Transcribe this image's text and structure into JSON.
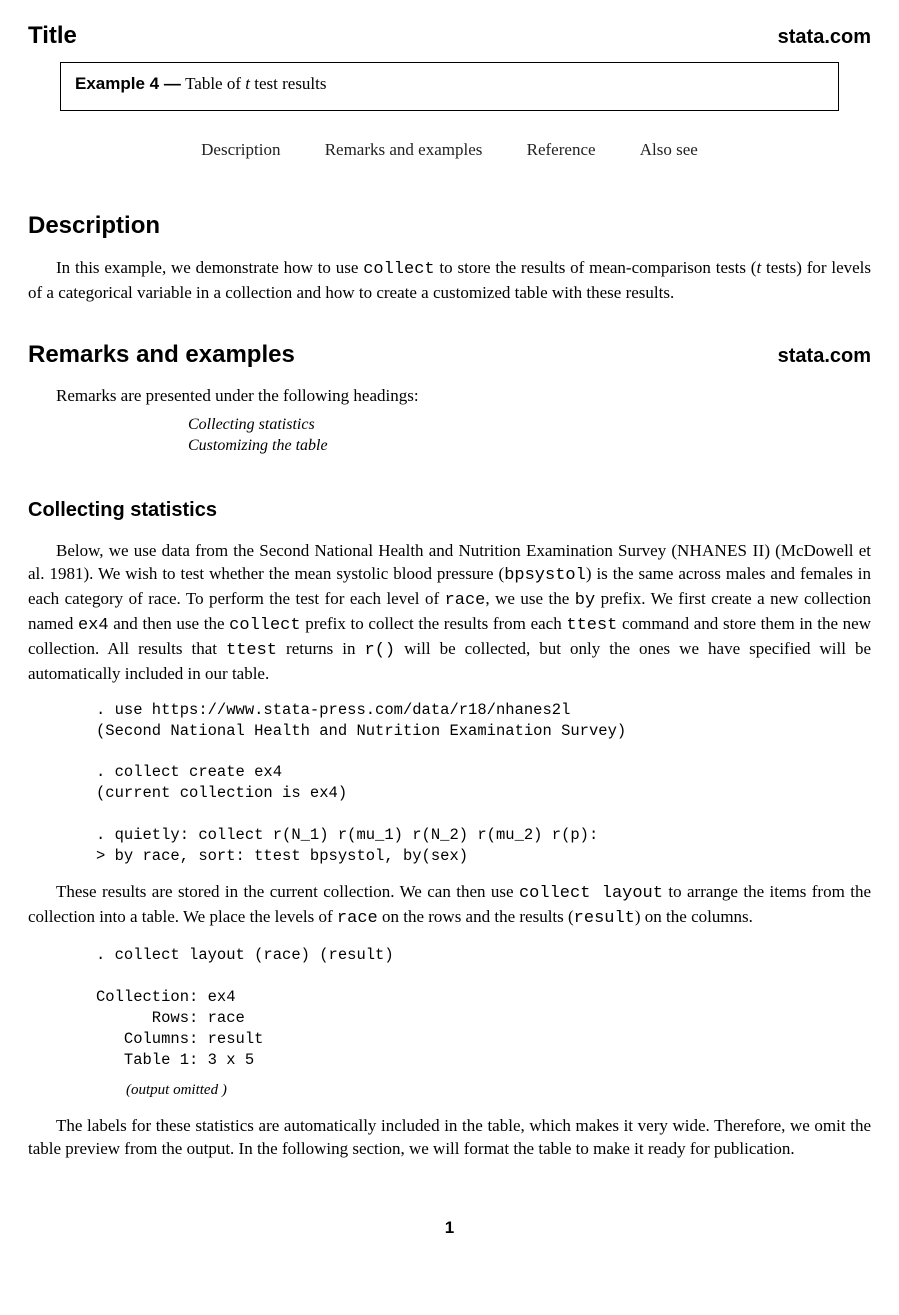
{
  "header": {
    "title_label": "Title",
    "brand": "stata.com"
  },
  "title_box": {
    "label": "Example 4 —",
    "desc_pre": " Table of ",
    "desc_var": "t",
    "desc_post": " test results"
  },
  "nav": {
    "description": "Description",
    "remarks": "Remarks and examples",
    "reference": "Reference",
    "also_see": "Also see"
  },
  "description": {
    "heading": "Description",
    "para_1a": "In this example, we demonstrate how to use ",
    "para_1_cmd1": "collect",
    "para_1b": " to store the results of mean-comparison tests (",
    "para_1_var": "t",
    "para_1c": " tests) for levels of a categorical variable in a collection and how to create a customized table with these results."
  },
  "remarks": {
    "heading": "Remarks and examples",
    "brand": "stata.com",
    "intro": "Remarks are presented under the following headings:",
    "sub1": "Collecting statistics",
    "sub2": "Customizing the table"
  },
  "collecting": {
    "heading": "Collecting statistics",
    "p1a": "Below, we use data from the Second National Health and Nutrition Examination Survey (",
    "p1_sc": "NHANES II",
    "p1b": ") (McDowell et al. 1981). We wish to test whether the mean systolic blood pressure (",
    "p1_v1": "bpsystol",
    "p1c": ") is the same across males and females in each category of race. To perform the test for each level of ",
    "p1_v2": "race",
    "p1d": ", we use the ",
    "p1_v3": "by",
    "p1e": " prefix. We first create a new collection named ",
    "p1_v4": "ex4",
    "p1f": " and then use the ",
    "p1_v5": "collect",
    "p1g": " prefix to collect the results from each ",
    "p1_v6": "ttest",
    "p1h": " command and store them in the new collection. All results that ",
    "p1_v7": "ttest",
    "p1i": " returns in ",
    "p1_v8": "r()",
    "p1j": " will be collected, but only the ones we have specified will be automatically included in our table.",
    "code1": ". use https://www.stata-press.com/data/r18/nhanes2l\n(Second National Health and Nutrition Examination Survey)\n\n. collect create ex4\n(current collection is ex4)\n\n. quietly: collect r(N_1) r(mu_1) r(N_2) r(mu_2) r(p):\n> by race, sort: ttest bpsystol, by(sex)",
    "p2a": "These results are stored in the current collection. We can then use ",
    "p2_v1": "collect layout",
    "p2b": " to arrange the items from the collection into a table. We place the levels of ",
    "p2_v2": "race",
    "p2c": " on the rows and the results (",
    "p2_v3": "result",
    "p2d": ") on the columns.",
    "code2": ". collect layout (race) (result)\n\nCollection: ex4\n      Rows: race\n   Columns: result\n   Table 1: 3 x 5",
    "omit_a": "(",
    "omit_b": "output omitted",
    "omit_c": " )",
    "p3": "The labels for these statistics are automatically included in the table, which makes it very wide. Therefore, we omit the table preview from the output. In the following section, we will format the table to make it ready for publication."
  },
  "page_number": "1"
}
